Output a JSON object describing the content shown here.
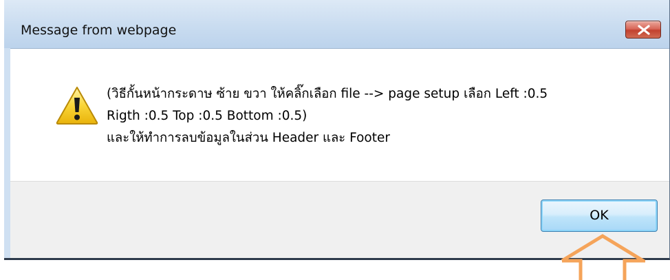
{
  "dialog": {
    "title": "Message from webpage",
    "close_icon": "close-icon",
    "warning_icon": "warning-icon",
    "message_lines": [
      "(วิธีกั้นหน้ากระดาษ ซ้าย ขวา ให้คลิ๊กเลือก file --> page setup เลือก Left :0.5",
      "Rigth :0.5 Top :0.5 Bottom :0.5)",
      " และให้ทำการลบข้อมูลในส่วน Header และ Footer"
    ],
    "ok_label": "OK"
  },
  "annotation": {
    "arrow_icon": "up-arrow-icon",
    "arrow_color": "#f5a45a"
  },
  "colors": {
    "titlebar": "#c9dcf0",
    "close_button": "#c2412f",
    "ok_button_border": "#3c7fb1",
    "footer": "#f0f0f0"
  }
}
